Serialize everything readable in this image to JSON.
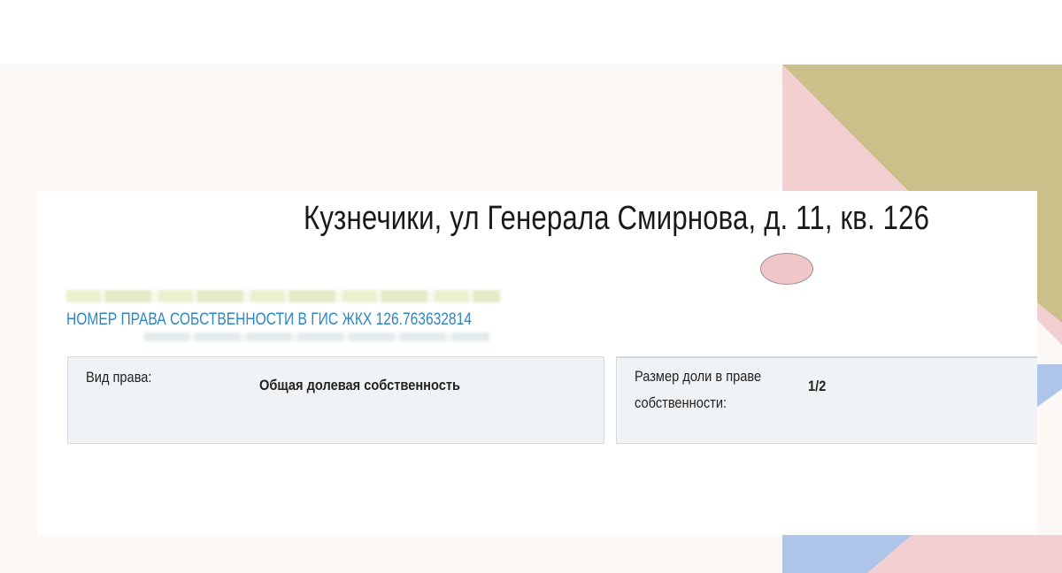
{
  "slide": {
    "partial_top_text": "",
    "address": "Кузнечики, ул Генерала Смирнова, д. 11, кв. 126"
  },
  "record": {
    "rights_number": "НОМЕР ПРАВА СОБСТВЕННОСТИ В ГИС ЖКХ 126.763632814",
    "right_type_label": "Вид права:",
    "right_type_value": "Общая долевая собственность",
    "share_size_label": "Размер доли в праве собственности:",
    "share_size_value": "1/2"
  },
  "colors": {
    "slide_bg": "#fcf8f5",
    "deco_olive": "#cbbf8a",
    "deco_pink": "#f2cfd0",
    "deco_blue": "#aec4e8",
    "link_blue": "#2e86bf",
    "box_bg": "#eff3f6"
  }
}
